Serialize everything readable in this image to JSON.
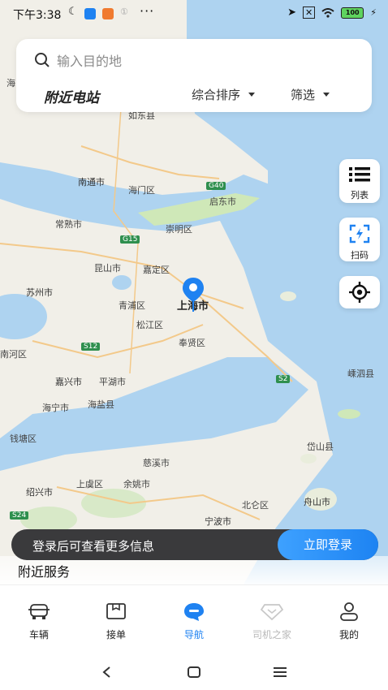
{
  "status_bar": {
    "time": "下午3:38",
    "dots": "···",
    "battery": "100"
  },
  "search": {
    "placeholder": "输入目的地"
  },
  "station_bar": {
    "title": "附近电站",
    "sort_label": "综合排序",
    "filter_label": "筛选"
  },
  "side_buttons": {
    "list_label": "列表",
    "scan_label": "扫码"
  },
  "map": {
    "labels": [
      "如东县",
      "南通市",
      "海门区",
      "启东市",
      "常熟市",
      "崇明区",
      "昆山市",
      "嘉定区",
      "苏州市",
      "青浦区",
      "上海市",
      "松江区",
      "奉贤区",
      "嘉兴市",
      "平湖市",
      "海宁市",
      "海盐县",
      "钱塘区",
      "慈溪市",
      "绍兴市",
      "上虞区",
      "余姚市",
      "宁波市",
      "北仑区",
      "舟山市",
      "岱山县",
      "嵊泗县",
      "南河区",
      "海"
    ],
    "roads": [
      "G40",
      "G15",
      "S12",
      "S2",
      "S24"
    ],
    "colors": {
      "water": "#aed3f0",
      "land": "#f1efe8",
      "green": "#cfe8b8",
      "pin": "#1f82f1"
    }
  },
  "login_bar": {
    "message": "登录后可查看更多信息",
    "button_label": "立即登录"
  },
  "nearby_services": {
    "title": "附近服务"
  },
  "tabs": [
    {
      "label": "车辆",
      "icon": "car-icon"
    },
    {
      "label": "接单",
      "icon": "order-box-icon"
    },
    {
      "label": "导航",
      "icon": "navigation-chat-icon"
    },
    {
      "label": "司机之家",
      "icon": "diamond-icon"
    },
    {
      "label": "我的",
      "icon": "user-icon"
    }
  ],
  "system_nav": {
    "icons": [
      "back-icon",
      "home-icon",
      "menu-icon"
    ]
  }
}
